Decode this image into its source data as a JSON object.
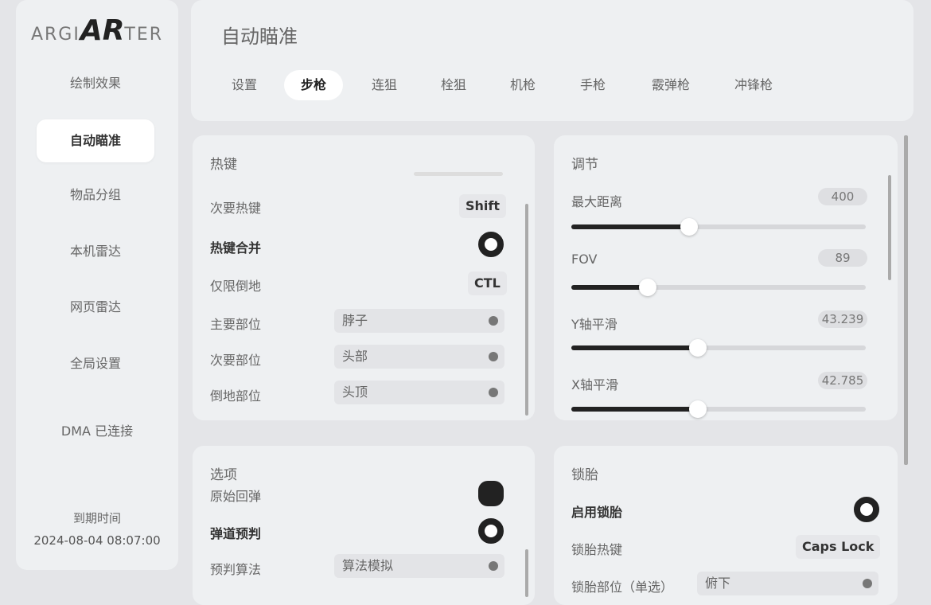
{
  "sidebar": {
    "logo_left": "ARGI",
    "logo_mid": "AR",
    "logo_right": "TER",
    "items": [
      {
        "label": "绘制效果"
      },
      {
        "label": "自动瞄准"
      },
      {
        "label": "物品分组"
      },
      {
        "label": "本机雷达"
      },
      {
        "label": "网页雷达"
      },
      {
        "label": "全局设置"
      }
    ],
    "active_index": 1,
    "dma_status": "DMA 已连接",
    "expiry_label": "到期时间",
    "expiry_value": "2024-08-04 08:07:00"
  },
  "header": {
    "title": "自动瞄准",
    "tabs": [
      {
        "label": "设置"
      },
      {
        "label": "步枪"
      },
      {
        "label": "连狙"
      },
      {
        "label": "栓狙"
      },
      {
        "label": "机枪"
      },
      {
        "label": "手枪"
      },
      {
        "label": "霰弹枪"
      },
      {
        "label": "冲锋枪"
      }
    ],
    "active_tab": 1
  },
  "hotkeys": {
    "title": "热键",
    "secondary_hotkey_label": "次要热键",
    "secondary_hotkey_value": "Shift",
    "merge_label": "热键合并",
    "merge_on": true,
    "downed_only_label": "仅限倒地",
    "downed_only_value": "CTL",
    "primary_part_label": "主要部位",
    "primary_part_value": "脖子",
    "secondary_part_label": "次要部位",
    "secondary_part_value": "头部",
    "downed_part_label": "倒地部位",
    "downed_part_value": "头顶"
  },
  "adjust": {
    "title": "调节",
    "sliders": [
      {
        "label": "最大距离",
        "value": "400",
        "fraction": 0.4
      },
      {
        "label": "FOV",
        "value": "89",
        "fraction": 0.26
      },
      {
        "label": "Y轴平滑",
        "value": "43.239",
        "fraction": 0.43
      },
      {
        "label": "X轴平滑",
        "value": "42.785",
        "fraction": 0.43
      }
    ]
  },
  "options": {
    "title": "选项",
    "raw_recoil_label": "原始回弹",
    "raw_recoil_on": true,
    "bullet_predict_label": "弹道预判",
    "bullet_predict_on": true,
    "predict_algo_label": "预判算法",
    "predict_algo_value": "算法模拟"
  },
  "lock": {
    "title": "锁胎",
    "enable_label": "启用锁胎",
    "enable_on": true,
    "hotkey_label": "锁胎热键",
    "hotkey_value": "Caps Lock",
    "part_label": "锁胎部位（单选）",
    "part_value": "俯下"
  }
}
